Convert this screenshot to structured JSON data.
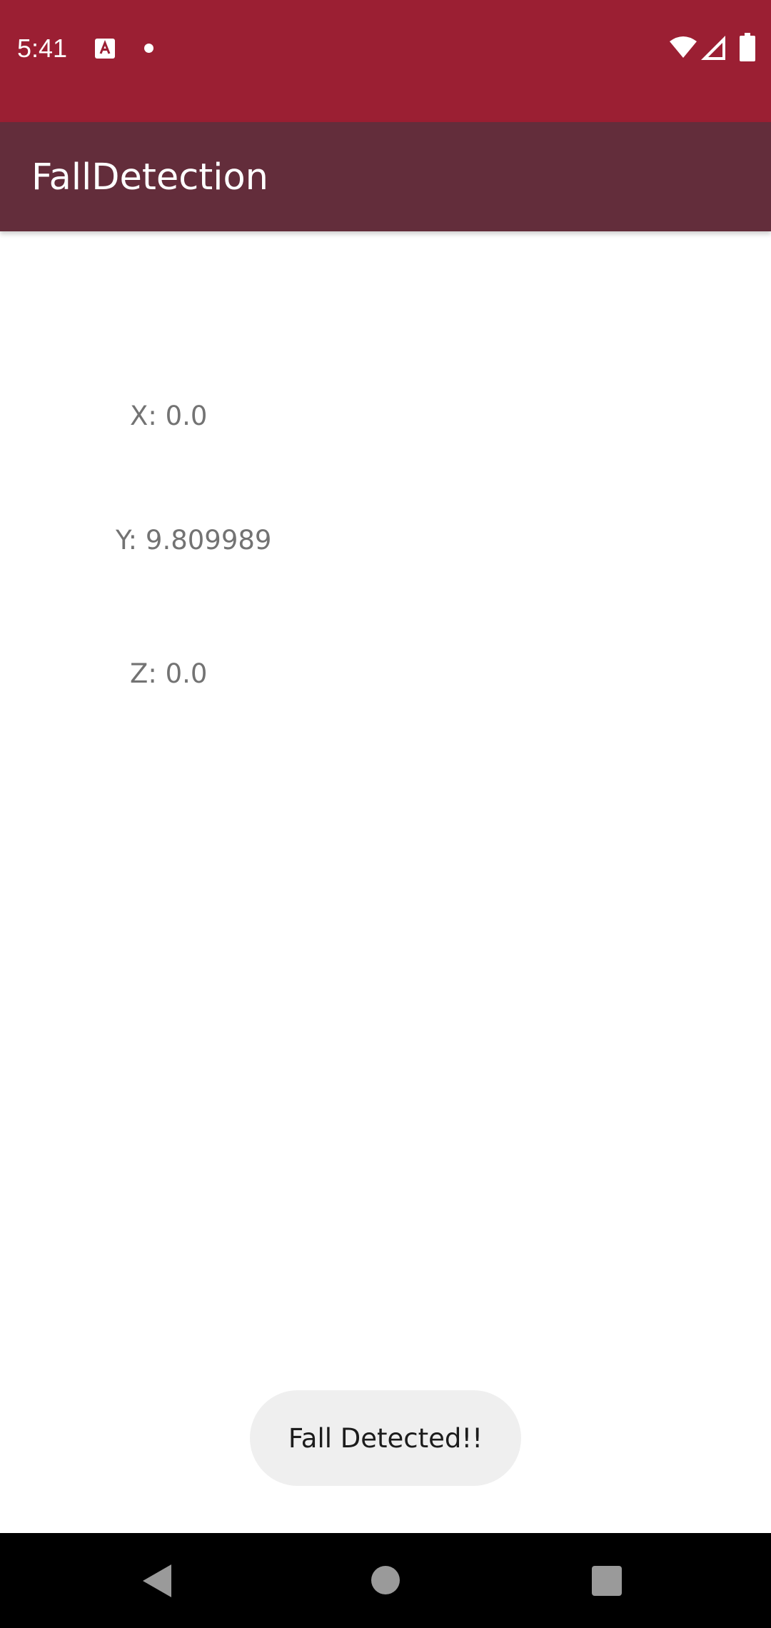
{
  "status_bar": {
    "time": "5:41",
    "color": "#9b1f33",
    "icons": [
      "notification-a-icon",
      "dot-icon",
      "wifi-icon",
      "signal-icon",
      "battery-icon"
    ]
  },
  "app_bar": {
    "title": "FallDetection",
    "color": "#632d3b"
  },
  "readings": {
    "x": "X: 0.0",
    "y": "Y: 9.809989",
    "z": "Z: 0.0"
  },
  "toast": {
    "message": "Fall Detected!!"
  },
  "nav_bar": {
    "icons": [
      "back-icon",
      "home-icon",
      "recents-icon"
    ]
  }
}
